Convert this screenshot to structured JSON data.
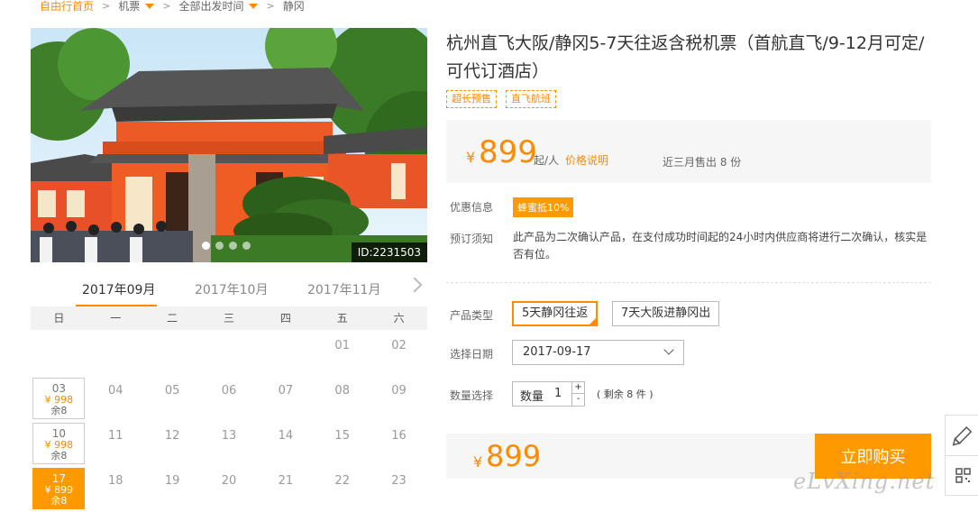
{
  "breadcrumb": {
    "home": "自由行首页",
    "flights": "机票",
    "departure": "全部出发时间",
    "current": "静冈"
  },
  "hero": {
    "photo_id": "ID:2231503"
  },
  "calendar": {
    "months": [
      "2017年09月",
      "2017年10月",
      "2017年11月"
    ],
    "active_month": "2017年09月",
    "weekdays": [
      "日",
      "一",
      "二",
      "三",
      "四",
      "五",
      "六"
    ],
    "days": [
      {
        "d": "01",
        "col": 5,
        "row": 0
      },
      {
        "d": "02",
        "col": 6,
        "row": 0
      },
      {
        "d": "03",
        "col": 0,
        "row": 1,
        "price": "¥ 998",
        "stock": "余8"
      },
      {
        "d": "04",
        "col": 1,
        "row": 1
      },
      {
        "d": "05",
        "col": 2,
        "row": 1
      },
      {
        "d": "06",
        "col": 3,
        "row": 1
      },
      {
        "d": "07",
        "col": 4,
        "row": 1
      },
      {
        "d": "08",
        "col": 5,
        "row": 1
      },
      {
        "d": "09",
        "col": 6,
        "row": 1
      },
      {
        "d": "10",
        "col": 0,
        "row": 2,
        "price": "¥ 998",
        "stock": "余8"
      },
      {
        "d": "11",
        "col": 1,
        "row": 2
      },
      {
        "d": "12",
        "col": 2,
        "row": 2
      },
      {
        "d": "13",
        "col": 3,
        "row": 2
      },
      {
        "d": "14",
        "col": 4,
        "row": 2
      },
      {
        "d": "15",
        "col": 5,
        "row": 2
      },
      {
        "d": "16",
        "col": 6,
        "row": 2
      },
      {
        "d": "17",
        "col": 0,
        "row": 3,
        "price": "¥ 899",
        "stock": "余8",
        "selected": true
      },
      {
        "d": "18",
        "col": 1,
        "row": 3
      },
      {
        "d": "19",
        "col": 2,
        "row": 3
      },
      {
        "d": "20",
        "col": 3,
        "row": 3
      },
      {
        "d": "21",
        "col": 4,
        "row": 3
      },
      {
        "d": "22",
        "col": 5,
        "row": 3
      },
      {
        "d": "23",
        "col": 6,
        "row": 3
      }
    ]
  },
  "product": {
    "title": "杭州直飞大阪/静冈5-7天往返含税机票（首航直飞/9-12月可定/可代订酒店）",
    "tags": [
      "超长预售",
      "直飞航班"
    ],
    "currency": "¥",
    "price": "899",
    "unit": "起/人",
    "price_explain": "价格说明",
    "sold": "近三月售出 8 份"
  },
  "info": {
    "promo_label": "优惠信息",
    "promo_badge": "蜂蜜抵10%",
    "notice_label": "预订须知",
    "notice_text": "此产品为二次确认产品，在支付成功时间起的24小时内供应商将进行二次确认，核实是否有位。"
  },
  "options": {
    "type_label": "产品类型",
    "types": [
      "5天静冈往返",
      "7天大阪进静冈出"
    ],
    "selected_type": "5天静冈往返",
    "date_label": "选择日期",
    "date_value": "2017-09-17",
    "qty_label": "数量选择",
    "qty_field_label": "数量",
    "qty_value": "1",
    "plus": "+",
    "minus": "-",
    "remaining": "( 剩余 8 件 )"
  },
  "buy": {
    "currency": "¥",
    "total": "899",
    "button": "立即购买"
  },
  "watermark": "eLvXing.net",
  "colors": {
    "accent": "#ff9900",
    "accent_text": "#ff8a00",
    "panel": "#f6f6f6"
  }
}
